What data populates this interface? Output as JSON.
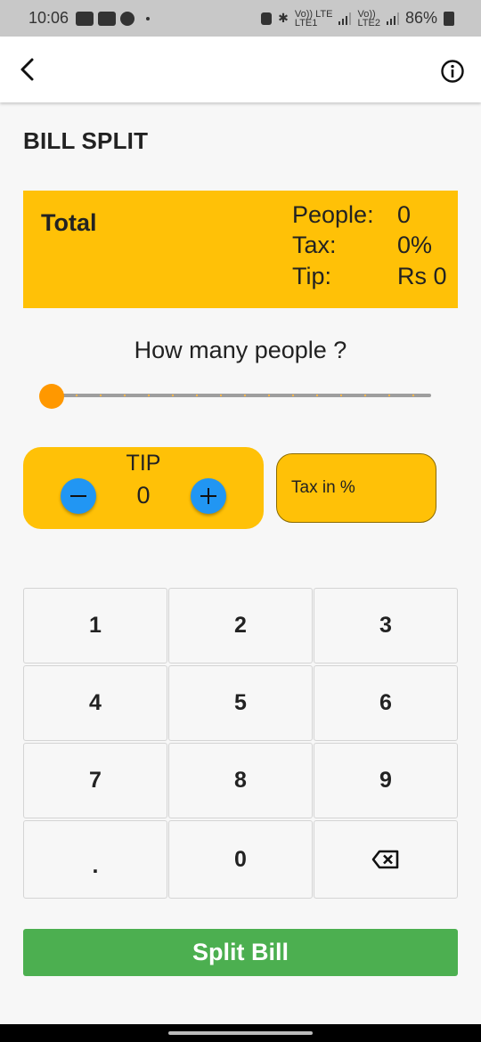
{
  "status_bar": {
    "time": "10:06",
    "net_label_1": "Vo)) LTE",
    "net_sub_1": "LTE1",
    "net_label_2": "Vo))",
    "net_sub_2": "LTE2",
    "battery": "86%"
  },
  "app_bar": {
    "back_icon": "chevron-left-icon",
    "info_icon": "info-circle-icon"
  },
  "page": {
    "title": "BILL SPLIT"
  },
  "summary": {
    "total_label": "Total",
    "people_label": "People:",
    "people_value": "0",
    "tax_label": "Tax:",
    "tax_value": "0%",
    "tip_label": "Tip:",
    "tip_value": "Rs 0"
  },
  "people_slider": {
    "question": "How many people ?",
    "value_fraction": 0
  },
  "tip": {
    "label": "TIP",
    "value": "0",
    "minus_icon": "minus-icon",
    "plus_icon": "plus-icon"
  },
  "tax_input": {
    "label": "Tax in %"
  },
  "keypad": {
    "keys": [
      "1",
      "2",
      "3",
      "4",
      "5",
      "6",
      "7",
      "8",
      "9",
      ".",
      "0",
      "backspace-icon"
    ]
  },
  "split_button": {
    "label": "Split Bill"
  },
  "colors": {
    "accent": "#ffc107",
    "slider": "#ff9800",
    "round_button": "#2196f3",
    "split_button": "#4caf50"
  }
}
